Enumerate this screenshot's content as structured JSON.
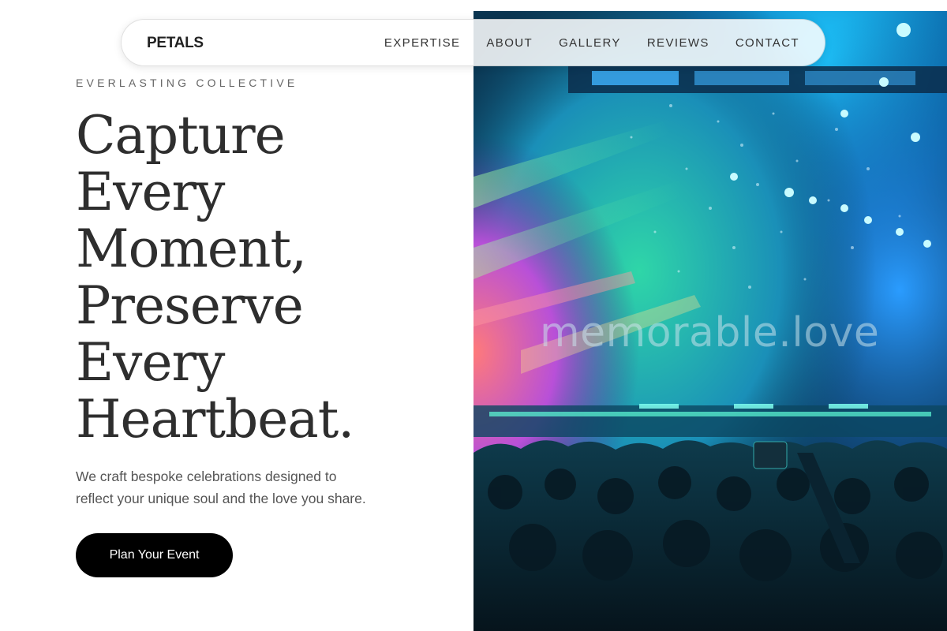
{
  "nav": {
    "brand": "PETALS",
    "links": [
      "EXPERTISE",
      "ABOUT",
      "GALLERY",
      "REVIEWS",
      "CONTACT"
    ]
  },
  "hero": {
    "eyebrow": "EVERLASTING COLLECTIVE",
    "headline": [
      "Capture",
      "Every",
      "Moment,",
      "Preserve",
      "Every",
      "Heartbeat."
    ],
    "subtext_lines": [
      "We craft bespoke celebrations designed to",
      "reflect your unique soul and the love you share."
    ],
    "cta_label": "Plan Your Event"
  },
  "image": {
    "subject": "concert crowd under neon stage lights",
    "watermark": "memorable.love"
  },
  "colors": {
    "background": "#ffffff",
    "headline": "#2e2e2e",
    "cta_bg": "#000000",
    "cta_text": "#ffffff"
  }
}
